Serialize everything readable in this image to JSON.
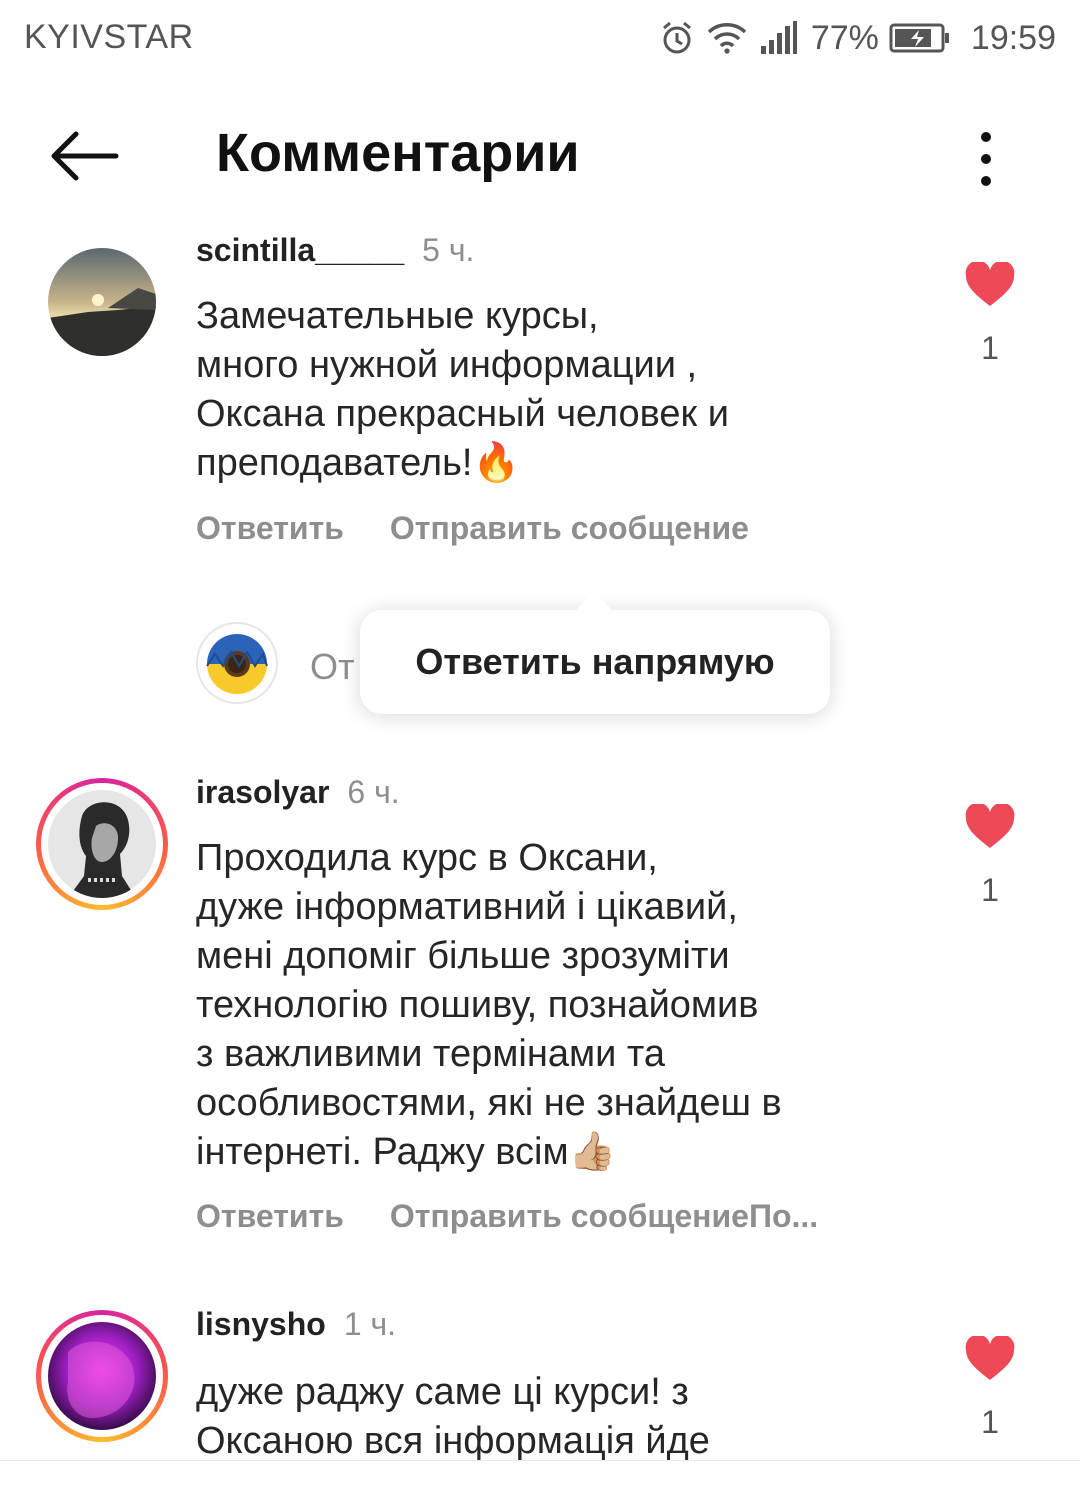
{
  "status_bar": {
    "carrier": "KYIVSTAR",
    "battery": "77%",
    "time": "19:59",
    "icons": [
      "alarm-icon",
      "wifi-icon",
      "signal-icon",
      "battery-icon"
    ]
  },
  "header": {
    "title": "Комментарии",
    "back_icon": "arrow-left-icon",
    "more_icon": "more-vertical-icon"
  },
  "comments": [
    {
      "username": "scintilla_____",
      "time": "5 ч.",
      "text_lines": [
        "Замечательные курсы,",
        "много нужной информации ,",
        "Оксана прекрасный человек и",
        "преподаватель!🔥"
      ],
      "reply_label": "Ответить",
      "send_label": "Отправить сообщение",
      "likes": "1"
    },
    {
      "username": "irasolyar",
      "time": "6 ч.",
      "text_lines": [
        "Проходила курс в Оксани,",
        "дуже інформативний і цікавий,",
        "мені допоміг більше зрозуміти",
        "технологію пошиву, познайомив",
        "з важливими термінами та",
        "особливостями, які не знайдеш в",
        "інтернеті. Раджу всім👍🏼"
      ],
      "reply_label": "Ответить",
      "send_label": "Отправить сообщениеПо...",
      "likes": "1"
    },
    {
      "username": "lisnysho",
      "time": "1 ч.",
      "text_lines": [
        "дуже раджу саме ці курси! з",
        "Оксаною вся інформація йде"
      ],
      "likes": "1"
    }
  ],
  "reply_input": {
    "partial_text": "От"
  },
  "tooltip": {
    "label": "Ответить напрямую"
  },
  "colors": {
    "like_red": "#ed4956",
    "muted_gray": "#8e8e8e"
  }
}
